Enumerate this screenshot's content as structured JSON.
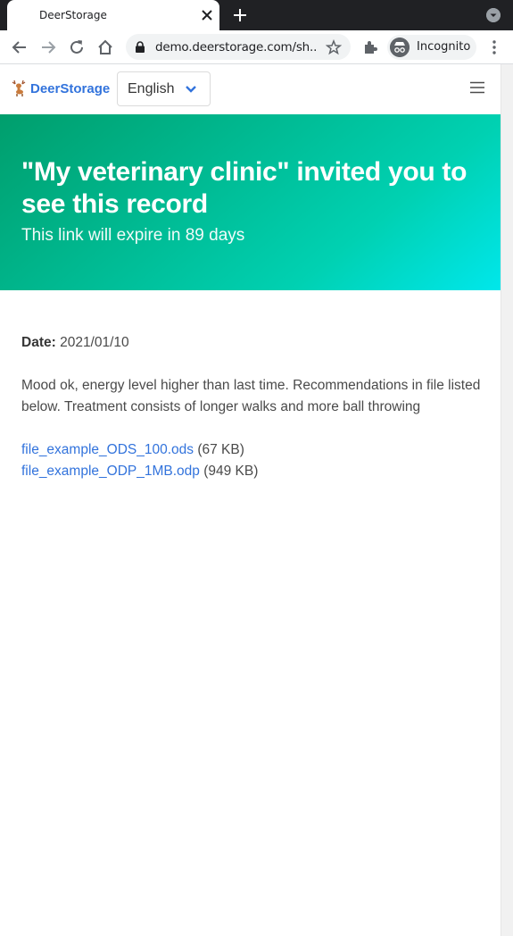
{
  "browser": {
    "tab_title": "DeerStorage",
    "url": "demo.deerstorage.com/sh...",
    "incognito_label": "Incognito"
  },
  "navbar": {
    "brand": "DeerStorage",
    "language": "English"
  },
  "hero": {
    "title": "\"My veterinary clinic\" invited you to see this record",
    "subtitle": "This link will expire in 89 days"
  },
  "record": {
    "date_label": "Date:",
    "date_value": "2021/01/10",
    "notes": "Mood ok, energy level higher than last time. Recommendations in file listed below. Treatment consists of longer walks and more ball throwing",
    "files": [
      {
        "name": "file_example_ODS_100.ods",
        "size": "(67 KB)"
      },
      {
        "name": "file_example_ODP_1MB.odp",
        "size": "(949 KB)"
      }
    ]
  },
  "colors": {
    "link": "#3273dc",
    "hero_start": "#009e6c",
    "hero_end": "#00e7eb"
  }
}
